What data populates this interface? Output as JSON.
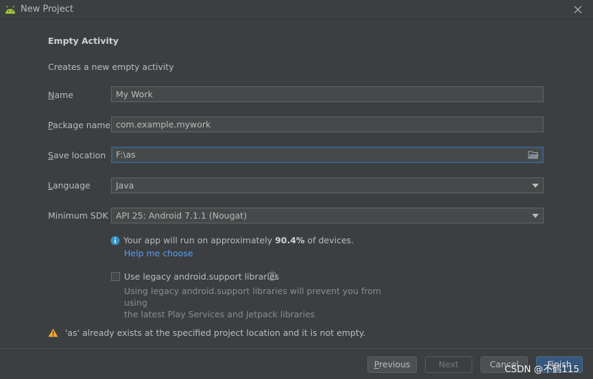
{
  "window": {
    "title": "New Project"
  },
  "page": {
    "heading": "Empty Activity",
    "subtitle": "Creates a new empty activity"
  },
  "form": {
    "name": {
      "label_mn": "N",
      "label_rest": "ame",
      "value": "My Work"
    },
    "package": {
      "label_mn": "P",
      "label_rest": "ackage name",
      "value": "com.example.mywork"
    },
    "save_location": {
      "label_mn": "S",
      "label_rest": "ave location",
      "value": "F:\\as"
    },
    "language": {
      "label_mn": "L",
      "label_rest": "anguage",
      "value": "Java"
    },
    "min_sdk": {
      "label": "Minimum SDK",
      "value": "API 25: Android 7.1.1 (Nougat)"
    }
  },
  "info": {
    "prefix": "Your app will run on approximately ",
    "percent": "90.4%",
    "suffix": " of devices.",
    "help_link": "Help me choose"
  },
  "legacy": {
    "checked": false,
    "label": "Use legacy android.support libraries",
    "desc_line1": "Using legacy android.support libraries will prevent you from using",
    "desc_line2": "the latest Play Services and Jetpack libraries"
  },
  "warning": {
    "text": "'as' already exists at the specified project location and it is not empty."
  },
  "buttons": {
    "previous_mn": "P",
    "previous_rest": "revious",
    "next": "Next",
    "cancel": "Cancel",
    "finish_mn": "F",
    "finish_rest": "inish"
  },
  "watermark": "CSDN @不鹤115",
  "colors": {
    "background": "#3c3f41",
    "field_bg": "#45494a",
    "focus_border": "#3d6185",
    "link": "#589df6",
    "info_icon": "#3592c4",
    "warning_icon": "#f0a732",
    "android_green": "#a4c639",
    "primary_button": "#365880"
  },
  "icons": {
    "title": "android-icon",
    "close": "close-icon",
    "folder": "folder-icon",
    "dropdown": "chevron-down-icon",
    "info": "info-icon",
    "help": "question-icon",
    "warning": "warning-icon"
  }
}
